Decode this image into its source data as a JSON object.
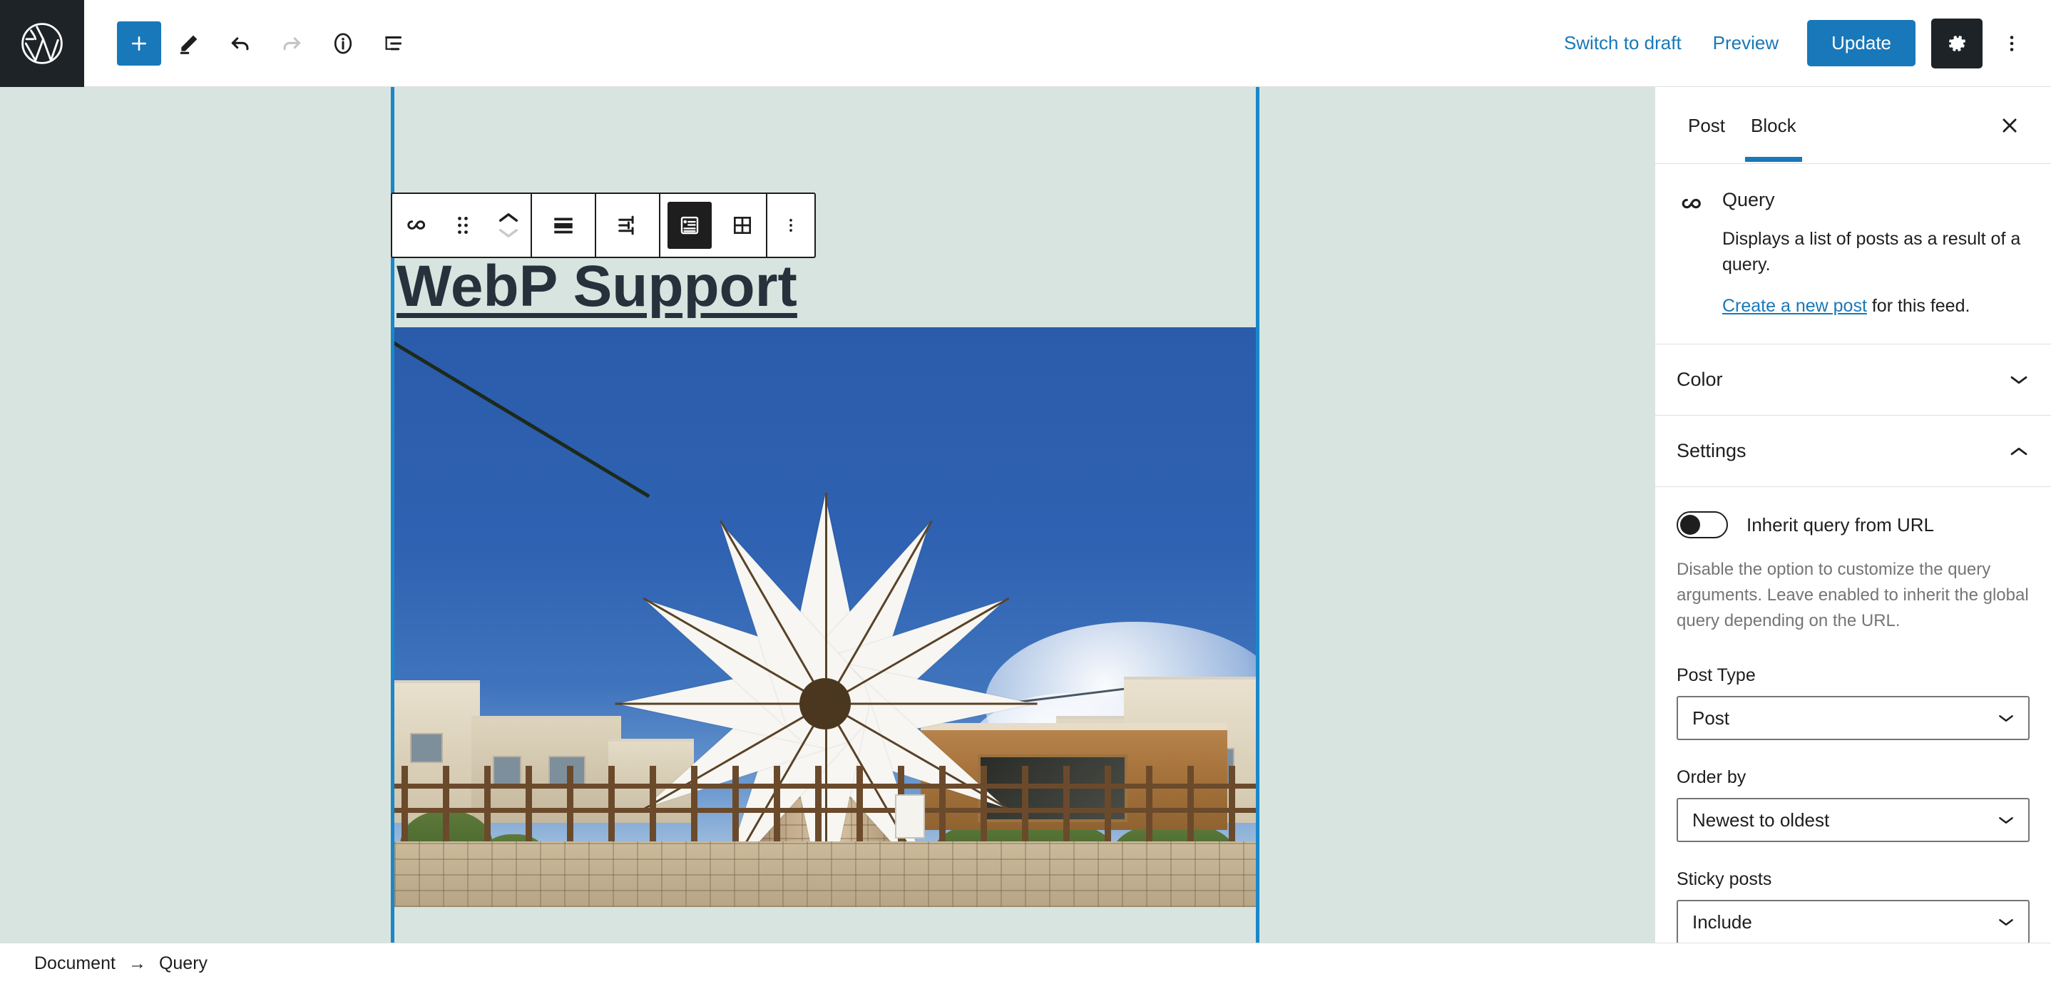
{
  "header": {
    "logo_icon": "wordpress-logo-icon",
    "tools": [
      {
        "name": "add-block-button",
        "icon": "plus-icon",
        "label": "Add block",
        "state": "primary"
      },
      {
        "name": "edit-tool-button",
        "icon": "pencil-icon",
        "label": "Tools",
        "state": "normal"
      },
      {
        "name": "undo-button",
        "icon": "undo-arrow-icon",
        "label": "Undo",
        "state": "normal"
      },
      {
        "name": "redo-button",
        "icon": "redo-arrow-icon",
        "label": "Redo",
        "state": "disabled"
      },
      {
        "name": "details-button",
        "icon": "info-circle-icon",
        "label": "Details",
        "state": "normal"
      },
      {
        "name": "list-view-button",
        "icon": "list-view-icon",
        "label": "List View",
        "state": "normal"
      }
    ],
    "switch_to_draft": "Switch to draft",
    "preview": "Preview",
    "update": "Update",
    "settings_icon": "gear-icon",
    "options_icon": "kebab-vertical-icon"
  },
  "block_toolbar": {
    "items": [
      {
        "name": "block-type-query-button",
        "icon": "query-loop-icon"
      },
      {
        "name": "drag-handle",
        "icon": "drag-dots-icon"
      },
      {
        "name": "move-up-button",
        "icon": "chevron-up-icon"
      },
      {
        "name": "move-down-button",
        "icon": "chevron-down-icon"
      },
      {
        "name": "align-button",
        "icon": "align-icon"
      },
      {
        "name": "display-settings-button",
        "icon": "sliders-icon"
      },
      {
        "name": "list-layout-button",
        "icon": "list-layout-icon"
      },
      {
        "name": "grid-layout-button",
        "icon": "grid-layout-icon"
      },
      {
        "name": "more-options-button",
        "icon": "kebab-vertical-icon"
      }
    ]
  },
  "canvas": {
    "post_title": "WebP Support",
    "background_color": "#d7e4df",
    "selection_color": "#1a87c9",
    "featured_image_alt": "White-sailed Greek stone windmill against a blue sky"
  },
  "sidebar": {
    "tabs": [
      {
        "label": "Post",
        "active": false
      },
      {
        "label": "Block",
        "active": true
      }
    ],
    "close_icon": "close-x-icon",
    "block": {
      "icon": "query-loop-icon",
      "title": "Query",
      "description": "Displays a list of posts as a result of a query.",
      "feed_link": "Create a new post",
      "feed_suffix": " for this feed."
    },
    "panels": [
      {
        "name": "color",
        "title": "Color",
        "expanded": false
      },
      {
        "name": "settings",
        "title": "Settings",
        "expanded": true
      }
    ],
    "settings": {
      "inherit_toggle_label": "Inherit query from URL",
      "inherit_toggle_state": "off",
      "inherit_help": "Disable the option to customize the query arguments. Leave enabled to inherit the global query depending on the URL.",
      "fields": [
        {
          "name": "post-type",
          "label": "Post Type",
          "value": "Post"
        },
        {
          "name": "order-by",
          "label": "Order by",
          "value": "Newest to oldest"
        },
        {
          "name": "sticky-posts",
          "label": "Sticky posts",
          "value": "Include"
        }
      ]
    }
  },
  "footer": {
    "crumbs": [
      "Document",
      "Query"
    ],
    "separator": "→"
  },
  "colors": {
    "accent_blue": "#1878b9",
    "dark": "#1e2327",
    "selection_blue": "#1a87c9"
  }
}
